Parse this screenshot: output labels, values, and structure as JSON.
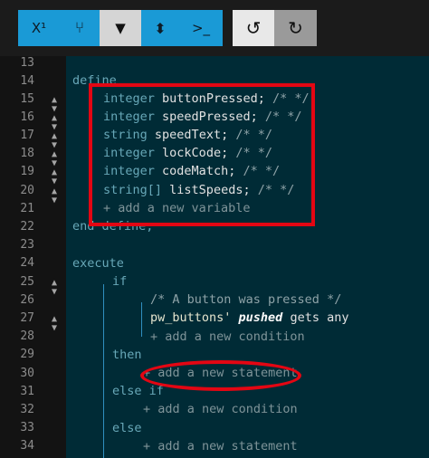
{
  "toolbar": {
    "buttons": [
      {
        "name": "superscript",
        "label": "X¹"
      },
      {
        "name": "branch",
        "label": "⑂"
      },
      {
        "name": "filter",
        "label": "▼"
      },
      {
        "name": "sort",
        "label": "⬍"
      },
      {
        "name": "terminal",
        "label": ">_"
      },
      {
        "name": "undo",
        "label": "↺"
      },
      {
        "name": "redo",
        "label": "↻"
      }
    ]
  },
  "gutter": {
    "line_numbers": [
      "13",
      "14",
      "15",
      "16",
      "17",
      "18",
      "19",
      "20",
      "21",
      "22",
      "23",
      "24",
      "25",
      "26",
      "27",
      "28",
      "29",
      "30",
      "31",
      "32",
      "33",
      "34"
    ]
  },
  "code": {
    "define_kw": "define",
    "variables": [
      {
        "type": "integer",
        "name": "buttonPressed",
        "comment": "/* */"
      },
      {
        "type": "integer",
        "name": "speedPressed",
        "comment": "/* */"
      },
      {
        "type": "string",
        "name": "speedText",
        "comment": "/* */"
      },
      {
        "type": "integer",
        "name": "lockCode",
        "comment": "/* */"
      },
      {
        "type": "integer",
        "name": "codeMatch",
        "comment": "/* */"
      },
      {
        "type": "string[]",
        "name": "listSpeeds",
        "comment": "/* */"
      }
    ],
    "add_variable": "+ add a new variable",
    "end_define": "end define;",
    "execute_kw": "execute",
    "if_kw": "if",
    "condition_comment": "/* A button was pressed */",
    "condition_subject": "pw_buttons'",
    "condition_event": "pushed",
    "condition_tail": "gets any",
    "add_condition_1": "+ add a new condition",
    "then_kw": "then",
    "add_statement_1": "+ add a new statement",
    "else_if_kw": "else if",
    "add_condition_2": "+ add a new condition",
    "else_kw": "else",
    "add_statement_2": "+ add a new statement"
  },
  "colors": {
    "highlight": "#e30613",
    "editor_bg": "#002b36",
    "accent": "#1a9ad6"
  }
}
